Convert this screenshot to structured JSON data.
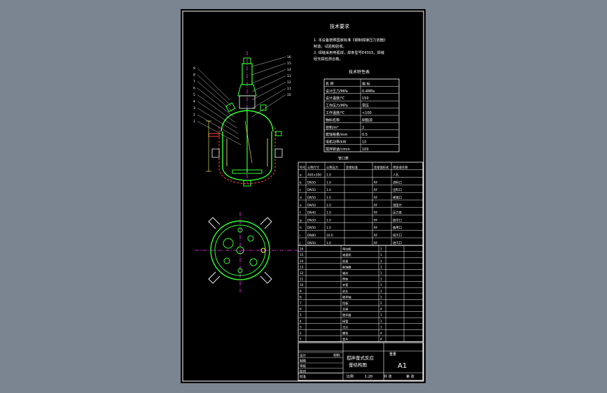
{
  "tech_requirements": {
    "title": "技术要求",
    "lines": [
      "1. 本设备按照国家标准《钢制焊接压力容器》",
      "   制造，试验和验收。",
      "2. 焊缝采用电弧焊，焊条型号E4303，焊缝",
      "   经无损检测合格。"
    ]
  },
  "tech_table": {
    "title": "技术特性表",
    "header": [
      "名 称",
      "指 标"
    ],
    "rows": [
      [
        "设计压力/MPa",
        "0.4MPa"
      ],
      [
        "设计温度/℃",
        "150"
      ],
      [
        "工作压力/MPa",
        "常压"
      ],
      [
        "工作温度/℃",
        "<100"
      ],
      [
        "物料名称",
        "树脂液"
      ],
      [
        "容积/m³",
        "2"
      ],
      [
        "腐蚀裕量/mm",
        "0.5"
      ],
      [
        "电机功率/kW",
        "10"
      ],
      [
        "搅拌转速/r/min",
        "100"
      ]
    ]
  },
  "nozzle_table": {
    "title": "管口表",
    "header": [
      "符号",
      "公称尺寸",
      "公称压力",
      "连接标准",
      "连接面形式",
      "用途或名称"
    ],
    "rows": [
      [
        "a",
        "400×300",
        "1.0",
        "",
        "",
        "人孔"
      ],
      [
        "b",
        "DN50",
        "1.0",
        "",
        "RF",
        "进料口"
      ],
      [
        "c",
        "DN50",
        "1.0",
        "",
        "RF",
        "出料口"
      ],
      [
        "d",
        "DN50",
        "1.0",
        "",
        "RF",
        "视镜口"
      ],
      [
        "e",
        "DN50",
        "1.0",
        "",
        "RF",
        "温度计"
      ],
      [
        "f",
        "DN40",
        "1.0",
        "",
        "RF",
        "压力表"
      ],
      [
        "g",
        "DN50",
        "1.0",
        "",
        "RF",
        "放空口"
      ],
      [
        "h",
        "DN50",
        "1.0",
        "",
        "RF",
        "备用口"
      ],
      [
        "i",
        "DN80",
        "10.0",
        "",
        "RF",
        "排污口"
      ],
      [
        "j",
        "DN50",
        "1.0",
        "",
        "RF",
        "进汽口"
      ]
    ]
  },
  "parts_table": {
    "rows": [
      [
        "16",
        "",
        "电动机",
        "1",
        "",
        ""
      ],
      [
        "15",
        "",
        "减速机",
        "1",
        "",
        ""
      ],
      [
        "14",
        "",
        "机架",
        "1",
        "",
        ""
      ],
      [
        "13",
        "",
        "联轴器",
        "1",
        "",
        ""
      ],
      [
        "12",
        "",
        "轴封",
        "1",
        "",
        ""
      ],
      [
        "11",
        "",
        "筒体",
        "1",
        "",
        ""
      ],
      [
        "10",
        "",
        "夹套",
        "1",
        "",
        ""
      ],
      [
        "9",
        "",
        "封头",
        "1",
        "",
        ""
      ],
      [
        "8",
        "",
        "搅拌轴",
        "1",
        "",
        ""
      ],
      [
        "7",
        "",
        "挡板",
        "2",
        "",
        ""
      ],
      [
        "6",
        "",
        "支座",
        "4",
        "",
        ""
      ],
      [
        "5",
        "",
        "搅拌器",
        "1",
        "",
        ""
      ],
      [
        "4",
        "",
        "接管",
        "1",
        "",
        ""
      ],
      [
        "3",
        "",
        "法兰",
        "1",
        "",
        ""
      ],
      [
        "2",
        "",
        "螺栓",
        "4",
        "",
        ""
      ],
      [
        "1",
        "",
        "垫片",
        "4",
        "",
        ""
      ]
    ]
  },
  "title_block": {
    "drawing_title_line1": "搅拌釜式反应",
    "drawing_title_line2": "釜结构图",
    "sheet_size": "A1",
    "scale": "1:20",
    "labels_left": [
      "设计",
      "制图",
      "审核",
      "校对",
      "批准"
    ],
    "label_material": "材料",
    "label_scale": "比例",
    "label_weight": "重量",
    "label_sheets": "共  张",
    "label_sheet_no": "第  张"
  },
  "callouts": {
    "left": [
      "9",
      "8",
      "7",
      "6",
      "5",
      "4",
      "3",
      "2",
      "1"
    ],
    "right": [
      "16",
      "15",
      "14",
      "13",
      "12",
      "11",
      "10"
    ]
  }
}
